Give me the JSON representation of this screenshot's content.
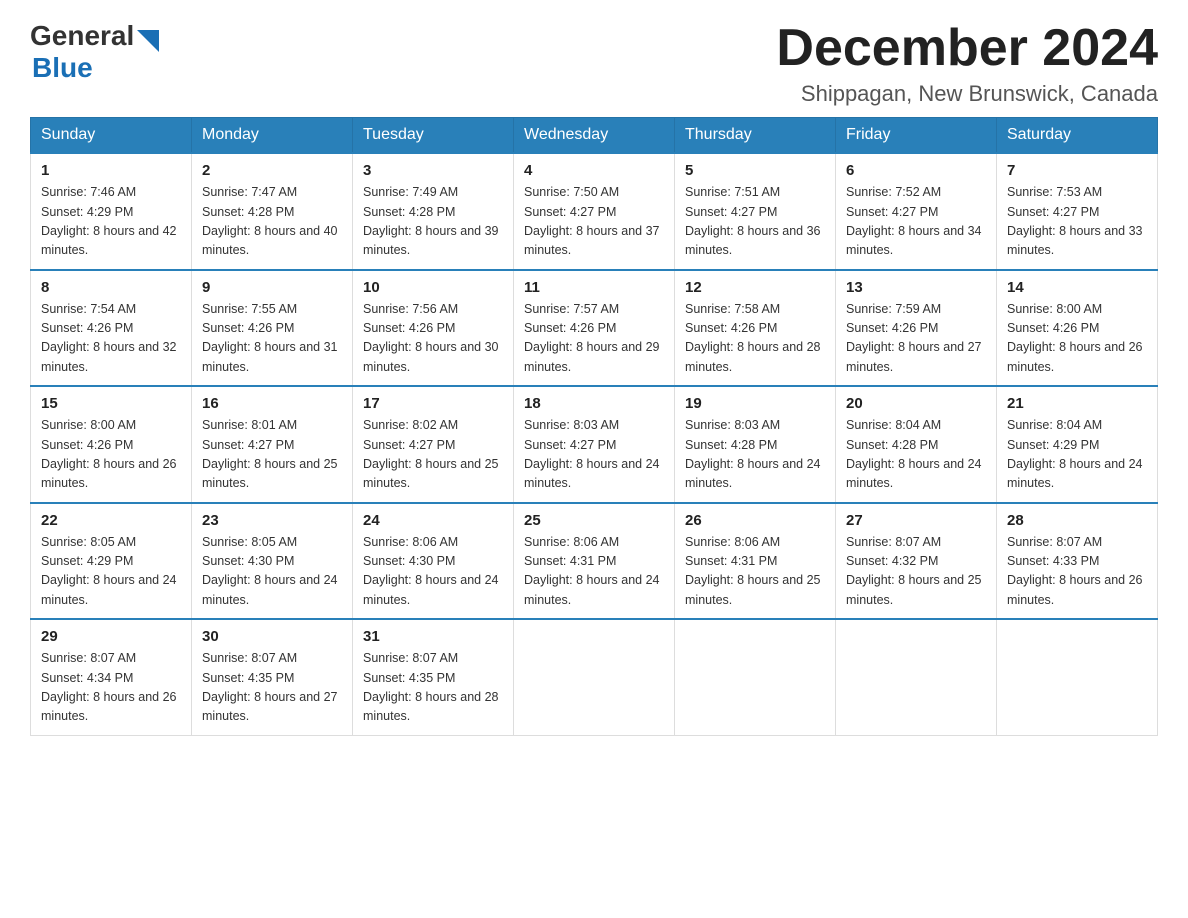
{
  "header": {
    "logo_general": "General",
    "logo_blue": "Blue",
    "title": "December 2024",
    "subtitle": "Shippagan, New Brunswick, Canada"
  },
  "weekdays": [
    "Sunday",
    "Monday",
    "Tuesday",
    "Wednesday",
    "Thursday",
    "Friday",
    "Saturday"
  ],
  "weeks": [
    [
      {
        "day": "1",
        "sunrise": "7:46 AM",
        "sunset": "4:29 PM",
        "daylight": "8 hours and 42 minutes."
      },
      {
        "day": "2",
        "sunrise": "7:47 AM",
        "sunset": "4:28 PM",
        "daylight": "8 hours and 40 minutes."
      },
      {
        "day": "3",
        "sunrise": "7:49 AM",
        "sunset": "4:28 PM",
        "daylight": "8 hours and 39 minutes."
      },
      {
        "day": "4",
        "sunrise": "7:50 AM",
        "sunset": "4:27 PM",
        "daylight": "8 hours and 37 minutes."
      },
      {
        "day": "5",
        "sunrise": "7:51 AM",
        "sunset": "4:27 PM",
        "daylight": "8 hours and 36 minutes."
      },
      {
        "day": "6",
        "sunrise": "7:52 AM",
        "sunset": "4:27 PM",
        "daylight": "8 hours and 34 minutes."
      },
      {
        "day": "7",
        "sunrise": "7:53 AM",
        "sunset": "4:27 PM",
        "daylight": "8 hours and 33 minutes."
      }
    ],
    [
      {
        "day": "8",
        "sunrise": "7:54 AM",
        "sunset": "4:26 PM",
        "daylight": "8 hours and 32 minutes."
      },
      {
        "day": "9",
        "sunrise": "7:55 AM",
        "sunset": "4:26 PM",
        "daylight": "8 hours and 31 minutes."
      },
      {
        "day": "10",
        "sunrise": "7:56 AM",
        "sunset": "4:26 PM",
        "daylight": "8 hours and 30 minutes."
      },
      {
        "day": "11",
        "sunrise": "7:57 AM",
        "sunset": "4:26 PM",
        "daylight": "8 hours and 29 minutes."
      },
      {
        "day": "12",
        "sunrise": "7:58 AM",
        "sunset": "4:26 PM",
        "daylight": "8 hours and 28 minutes."
      },
      {
        "day": "13",
        "sunrise": "7:59 AM",
        "sunset": "4:26 PM",
        "daylight": "8 hours and 27 minutes."
      },
      {
        "day": "14",
        "sunrise": "8:00 AM",
        "sunset": "4:26 PM",
        "daylight": "8 hours and 26 minutes."
      }
    ],
    [
      {
        "day": "15",
        "sunrise": "8:00 AM",
        "sunset": "4:26 PM",
        "daylight": "8 hours and 26 minutes."
      },
      {
        "day": "16",
        "sunrise": "8:01 AM",
        "sunset": "4:27 PM",
        "daylight": "8 hours and 25 minutes."
      },
      {
        "day": "17",
        "sunrise": "8:02 AM",
        "sunset": "4:27 PM",
        "daylight": "8 hours and 25 minutes."
      },
      {
        "day": "18",
        "sunrise": "8:03 AM",
        "sunset": "4:27 PM",
        "daylight": "8 hours and 24 minutes."
      },
      {
        "day": "19",
        "sunrise": "8:03 AM",
        "sunset": "4:28 PM",
        "daylight": "8 hours and 24 minutes."
      },
      {
        "day": "20",
        "sunrise": "8:04 AM",
        "sunset": "4:28 PM",
        "daylight": "8 hours and 24 minutes."
      },
      {
        "day": "21",
        "sunrise": "8:04 AM",
        "sunset": "4:29 PM",
        "daylight": "8 hours and 24 minutes."
      }
    ],
    [
      {
        "day": "22",
        "sunrise": "8:05 AM",
        "sunset": "4:29 PM",
        "daylight": "8 hours and 24 minutes."
      },
      {
        "day": "23",
        "sunrise": "8:05 AM",
        "sunset": "4:30 PM",
        "daylight": "8 hours and 24 minutes."
      },
      {
        "day": "24",
        "sunrise": "8:06 AM",
        "sunset": "4:30 PM",
        "daylight": "8 hours and 24 minutes."
      },
      {
        "day": "25",
        "sunrise": "8:06 AM",
        "sunset": "4:31 PM",
        "daylight": "8 hours and 24 minutes."
      },
      {
        "day": "26",
        "sunrise": "8:06 AM",
        "sunset": "4:31 PM",
        "daylight": "8 hours and 25 minutes."
      },
      {
        "day": "27",
        "sunrise": "8:07 AM",
        "sunset": "4:32 PM",
        "daylight": "8 hours and 25 minutes."
      },
      {
        "day": "28",
        "sunrise": "8:07 AM",
        "sunset": "4:33 PM",
        "daylight": "8 hours and 26 minutes."
      }
    ],
    [
      {
        "day": "29",
        "sunrise": "8:07 AM",
        "sunset": "4:34 PM",
        "daylight": "8 hours and 26 minutes."
      },
      {
        "day": "30",
        "sunrise": "8:07 AM",
        "sunset": "4:35 PM",
        "daylight": "8 hours and 27 minutes."
      },
      {
        "day": "31",
        "sunrise": "8:07 AM",
        "sunset": "4:35 PM",
        "daylight": "8 hours and 28 minutes."
      },
      null,
      null,
      null,
      null
    ]
  ],
  "labels": {
    "sunrise": "Sunrise:",
    "sunset": "Sunset:",
    "daylight": "Daylight:"
  }
}
